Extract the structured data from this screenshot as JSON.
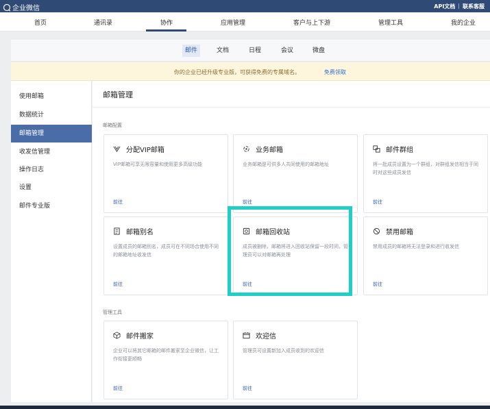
{
  "topbar": {
    "logo_text": "企业微信",
    "links": [
      "API文档",
      "联系客服"
    ],
    "separator": "|"
  },
  "main_nav": {
    "items": [
      "首页",
      "通讯录",
      "协作",
      "应用管理",
      "客户与上下游",
      "管理工具",
      "我的企业"
    ],
    "active": "协作"
  },
  "sub_nav": {
    "tabs": [
      "邮件",
      "文档",
      "日程",
      "会议",
      "微盘"
    ],
    "active": "邮件"
  },
  "notice": {
    "text": "你的企业已经升级专业版，可获得免费的专属域名。",
    "link": "免费领取"
  },
  "sidebar": {
    "items": [
      "使用邮箱",
      "数据统计",
      "邮箱管理",
      "收发信管理",
      "操作日志",
      "设置",
      "邮件专业版"
    ],
    "active": "邮箱管理"
  },
  "content": {
    "title": "邮箱管理",
    "sections": [
      {
        "label": "邮箱配置",
        "cards": [
          {
            "icon": "v-icon",
            "title": "分配VIP邮箱",
            "desc": "VIP邮箱可享无限容量和使用更多高级功能",
            "link": "前往"
          },
          {
            "icon": "business-icon",
            "title": "业务邮箱",
            "desc": "业务邮箱是可供多人共同使用的邮箱地址",
            "link": "前往"
          },
          {
            "icon": "group-icon",
            "title": "邮件群组",
            "desc": "将一批成员设置为一个群组，对群组发信相当于同时对这些成员发信",
            "link": "前往"
          },
          {
            "icon": "alias-icon",
            "title": "邮箱别名",
            "desc": "设置成员的邮箱别名，成员可在不同场合使用不同的邮箱地址收发信",
            "link": "前往"
          },
          {
            "icon": "recycle-icon",
            "title": "邮箱回收站",
            "desc": "成员被删除，邮箱将进入回收站保留一段时间，管理员可以对邮箱再处理",
            "link": "前往"
          },
          {
            "icon": "ban-icon",
            "title": "禁用邮箱",
            "desc": "禁用成员的邮箱将无法登录和进行收发信",
            "link": "前往"
          }
        ]
      },
      {
        "label": "管理工具",
        "cards": [
          {
            "icon": "box-icon",
            "title": "邮件搬家",
            "desc": "企业可以将其它邮箱的邮件搬家至企业微信，让工作衔接更顺畅",
            "link": "前往"
          },
          {
            "icon": "welcome-icon",
            "title": "欢迎信",
            "desc": "管理员可设置新加入成员收到的欢迎信",
            "link": "前往"
          }
        ]
      }
    ]
  },
  "colors": {
    "topbar": "#2f4a74",
    "sidebar_active": "#4a6da7",
    "link": "#2f5ba7",
    "highlight": "#1ecfc7",
    "notice_bg": "#fdf6dc"
  }
}
